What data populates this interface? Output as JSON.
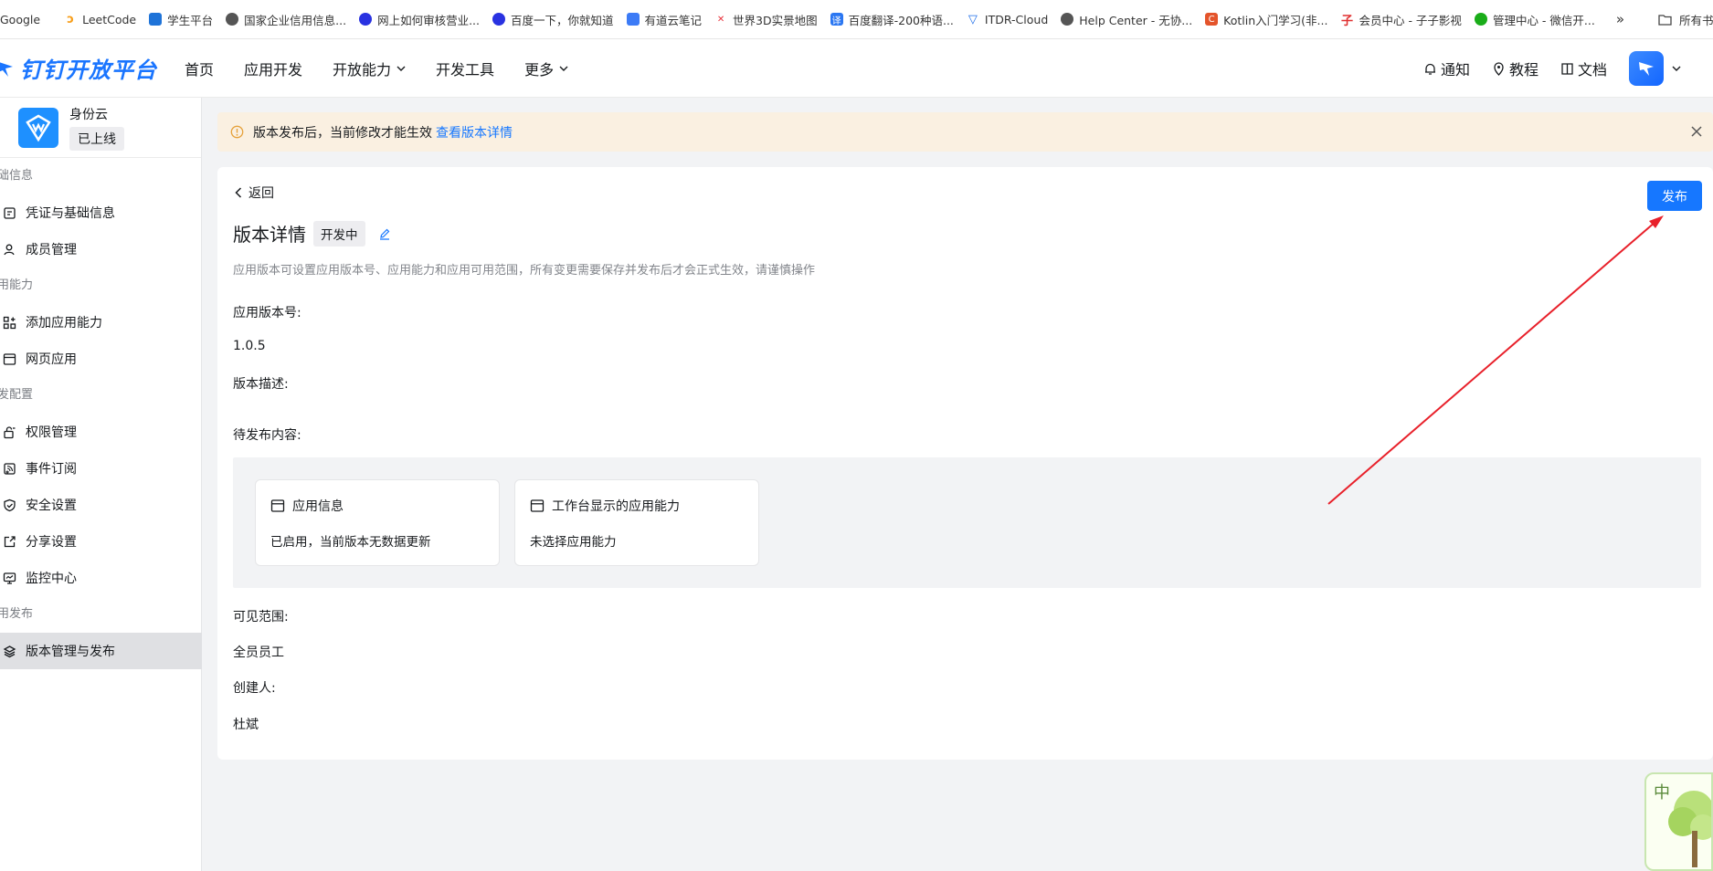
{
  "bookmarks": {
    "items": [
      {
        "label": "Google",
        "icon": "google-icon",
        "color": "#ffffff"
      },
      {
        "label": "LeetCode",
        "icon": "leetcode-icon",
        "color": "#f89f1b"
      },
      {
        "label": "学生平台",
        "icon": "monitor-icon",
        "color": "#1e73d8"
      },
      {
        "label": "国家企业信用信息...",
        "icon": "globe-icon",
        "color": "#555555"
      },
      {
        "label": "网上如何审核营业...",
        "icon": "baidu-paw-icon",
        "color": "#2932e1"
      },
      {
        "label": "百度一下，你就知道",
        "icon": "baidu-paw-icon",
        "color": "#2932e1"
      },
      {
        "label": "有道云笔记",
        "icon": "note-icon",
        "color": "#3c7bf6"
      },
      {
        "label": "世界3D实景地图",
        "icon": "map-icon",
        "color": "#e8333c"
      },
      {
        "label": "百度翻译-200种语...",
        "icon": "translate-icon",
        "color": "#2b77f2"
      },
      {
        "label": "ITDR-Cloud",
        "icon": "shield-icon",
        "color": "#1e6ee8"
      },
      {
        "label": "Help Center - 无协...",
        "icon": "globe-icon",
        "color": "#555555"
      },
      {
        "label": "Kotlin入门学习(非...",
        "icon": "c-icon",
        "color": "#e4542b"
      },
      {
        "label": "会员中心 - 子子影视",
        "icon": "zi-icon",
        "color": "#e03030"
      },
      {
        "label": "管理中心 - 微信开...",
        "icon": "wechat-icon",
        "color": "#1aad19"
      }
    ],
    "more": "»",
    "all_label": "所有书签"
  },
  "header": {
    "logo_text": "钉钉开放平台",
    "nav": [
      {
        "label": "首页",
        "dropdown": false
      },
      {
        "label": "应用开发",
        "dropdown": false
      },
      {
        "label": "开放能力",
        "dropdown": true
      },
      {
        "label": "开发工具",
        "dropdown": false
      },
      {
        "label": "更多",
        "dropdown": true
      }
    ],
    "notify": "通知",
    "tutorial": "教程",
    "docs": "文档"
  },
  "sidebar": {
    "app_name": "身份云",
    "app_status": "已上线",
    "groups": [
      {
        "title": "础信息",
        "items": [
          {
            "label": "凭证与基础信息",
            "icon": "credential-icon"
          },
          {
            "label": "成员管理",
            "icon": "user-icon"
          }
        ]
      },
      {
        "title": "用能力",
        "items": [
          {
            "label": "添加应用能力",
            "icon": "apps-add-icon"
          },
          {
            "label": "网页应用",
            "icon": "browser-window-icon"
          }
        ]
      },
      {
        "title": "发配置",
        "items": [
          {
            "label": "权限管理",
            "icon": "lock-icon"
          },
          {
            "label": "事件订阅",
            "icon": "subscribe-icon"
          },
          {
            "label": "安全设置",
            "icon": "shield-icon"
          },
          {
            "label": "分享设置",
            "icon": "share-icon"
          },
          {
            "label": "监控中心",
            "icon": "monitor-icon"
          }
        ]
      },
      {
        "title": "用发布",
        "items": [
          {
            "label": "版本管理与发布",
            "icon": "layers-icon",
            "active": true
          }
        ]
      }
    ]
  },
  "notice": {
    "text": "版本发布后，当前修改才能生效",
    "link": "查看版本详情"
  },
  "main": {
    "back": "返回",
    "publish": "发布",
    "title": "版本详情",
    "status": "开发中",
    "description": "应用版本可设置应用版本号、应用能力和应用可用范围，所有变更需要保存并发布后才会正式生效，请谨慎操作",
    "version_label": "应用版本号:",
    "version_value": "1.0.5",
    "desc_label": "版本描述:",
    "pending_label": "待发布内容:",
    "pending_cards": [
      {
        "title": "应用信息",
        "body": "已启用，当前版本无数据更新"
      },
      {
        "title": "工作台显示的应用能力",
        "body": "未选择应用能力"
      }
    ],
    "scope_label": "可见范围:",
    "scope_value": "全员员工",
    "creator_label": "创建人:",
    "creator_value": "杜斌"
  },
  "colors": {
    "primary": "#1677ff",
    "annotation_arrow": "#e8202a",
    "notice_bg": "#faf0e1"
  },
  "widget": {
    "char": "中"
  }
}
